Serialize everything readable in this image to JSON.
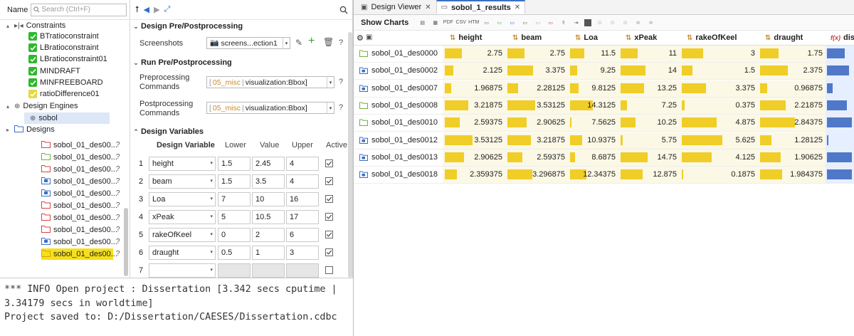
{
  "tree": {
    "name_label": "Name",
    "search_placeholder": "Search (Ctrl+F)",
    "nodes": [
      {
        "kind": "group",
        "label": "Constraints",
        "indent": 0,
        "twisty": "▴"
      },
      {
        "kind": "constraint",
        "label": "BTratioconstraint",
        "ok": true
      },
      {
        "kind": "constraint",
        "label": "LBratioconstraint",
        "ok": true
      },
      {
        "kind": "constraint",
        "label": "LBratioconstraint01",
        "ok": true
      },
      {
        "kind": "constraint",
        "label": "MINDRAFT",
        "ok": true
      },
      {
        "kind": "constraint",
        "label": "MINFREEBOARD",
        "ok": true
      },
      {
        "kind": "constraint",
        "label": "ratioDifference01",
        "ok": false
      },
      {
        "kind": "group",
        "label": "Design Engines",
        "indent": 0,
        "twisty": "▴"
      },
      {
        "kind": "engine",
        "label": "sobol"
      },
      {
        "kind": "folder",
        "label": "Designs",
        "twisty": "▸"
      }
    ],
    "designs": [
      {
        "label": "sobol_01_des00...",
        "color": "red",
        "suffix": "?"
      },
      {
        "label": "sobol_01_des00...",
        "color": "green",
        "suffix": "?"
      },
      {
        "label": "sobol_01_des00...",
        "color": "red",
        "suffix": "?"
      },
      {
        "label": "sobol_01_des00...",
        "color": "blue",
        "suffix": "?"
      },
      {
        "label": "sobol_01_des00...",
        "color": "blue",
        "suffix": "?"
      },
      {
        "label": "sobol_01_des00...",
        "color": "red",
        "suffix": "?"
      },
      {
        "label": "sobol_01_des00...",
        "color": "red",
        "suffix": "?"
      },
      {
        "label": "sobol_01_des00...",
        "color": "red",
        "suffix": "?"
      },
      {
        "label": "sobol_01_des00...",
        "color": "blue",
        "suffix": "?"
      },
      {
        "label": "sobol_01_des00...",
        "color": "yellow",
        "suffix": "?"
      }
    ]
  },
  "props": {
    "section_prepost": "Design Pre/Postprocessing",
    "screenshots_label": "Screenshots",
    "screenshots_value": "screens...ection1",
    "section_run": "Run Pre/Postprocessing",
    "pre_label": "Preprocessing Commands",
    "pre_value_prefix": "05_misc",
    "pre_value": "visualization:Bbox]",
    "post_label": "Postprocessing Commands",
    "post_value_prefix": "05_misc",
    "post_value": "visualization:Bbox]",
    "help_mark": "?",
    "section_vars": "Design Variables",
    "headers": {
      "name": "Design Variable",
      "lower": "Lower",
      "value": "Value",
      "upper": "Upper",
      "active": "Active"
    },
    "variables": [
      {
        "n": "1",
        "name": "height",
        "lower": "1.5",
        "value": "2.45",
        "upper": "4",
        "active": true
      },
      {
        "n": "2",
        "name": "beam",
        "lower": "1.5",
        "value": "3.5",
        "upper": "4",
        "active": true
      },
      {
        "n": "3",
        "name": "Loa",
        "lower": "7",
        "value": "10",
        "upper": "16",
        "active": true
      },
      {
        "n": "4",
        "name": "xPeak",
        "lower": "5",
        "value": "10.5",
        "upper": "17",
        "active": true
      },
      {
        "n": "5",
        "name": "rakeOfKeel",
        "lower": "0",
        "value": "2",
        "upper": "6",
        "active": true
      },
      {
        "n": "6",
        "name": "draught",
        "lower": "0.5",
        "value": "1",
        "upper": "3",
        "active": true
      },
      {
        "n": "7",
        "name": "",
        "lower": "",
        "value": "",
        "upper": "",
        "active": false
      }
    ]
  },
  "console": {
    "lines": [
      "*** INFO Open project : Dissertation [3.342 secs cputime |",
      "3.34179 secs in worldtime]",
      "Project saved to: D:/Dissertation/CAESES/Dissertation.cdbc"
    ]
  },
  "results": {
    "tabs": [
      {
        "label": "Design Viewer",
        "active": false
      },
      {
        "label": "sobol_1_results",
        "active": true
      }
    ],
    "show_charts": "Show Charts",
    "columns": [
      "height",
      "beam",
      "Loa",
      "xPeak",
      "rakeOfKeel",
      "draught",
      "disp"
    ],
    "ranges": {
      "height": [
        1.5,
        4
      ],
      "beam": [
        1.5,
        4
      ],
      "Loa": [
        7,
        16
      ],
      "xPeak": [
        5,
        17
      ],
      "rakeOfKeel": [
        0,
        6
      ],
      "draught": [
        0.5,
        3
      ]
    },
    "rows": [
      {
        "name": "sobol_01_des0000",
        "status": "green",
        "height": "2.75",
        "beam": "2.75",
        "Loa": "11.5",
        "xPeak": "11",
        "rakeOfKeel": "3",
        "draught": "1.75",
        "disp_frac": 0.7
      },
      {
        "name": "sobol_01_des0002",
        "status": "blue",
        "height": "2.125",
        "beam": "3.375",
        "Loa": "9.25",
        "xPeak": "14",
        "rakeOfKeel": "1.5",
        "draught": "2.375",
        "disp_frac": 0.85
      },
      {
        "name": "sobol_01_des0007",
        "status": "blue",
        "height": "1.96875",
        "beam": "2.28125",
        "Loa": "9.8125",
        "xPeak": "13.25",
        "rakeOfKeel": "3.375",
        "draught": "0.96875",
        "disp_frac": 0.22
      },
      {
        "name": "sobol_01_des0008",
        "status": "green",
        "height": "3.21875",
        "beam": "3.53125",
        "Loa": "14.3125",
        "xPeak": "7.25",
        "rakeOfKeel": "0.375",
        "draught": "2.21875",
        "disp_frac": 0.78
      },
      {
        "name": "sobol_01_des0010",
        "status": "green",
        "height": "2.59375",
        "beam": "2.90625",
        "Loa": "7.5625",
        "xPeak": "10.25",
        "rakeOfKeel": "4.875",
        "draught": "2.84375",
        "disp_frac": 0.98
      },
      {
        "name": "sobol_01_des0012",
        "status": "blue",
        "height": "3.53125",
        "beam": "3.21875",
        "Loa": "10.9375",
        "xPeak": "5.75",
        "rakeOfKeel": "5.625",
        "draught": "1.28125",
        "disp_frac": 0.06
      },
      {
        "name": "sobol_01_des0013",
        "status": "blue",
        "height": "2.90625",
        "beam": "2.59375",
        "Loa": "8.6875",
        "xPeak": "14.75",
        "rakeOfKeel": "4.125",
        "draught": "1.90625",
        "disp_frac": 0.98
      },
      {
        "name": "sobol_01_des0018",
        "status": "blue",
        "height": "2.359375",
        "beam": "3.296875",
        "Loa": "12.34375",
        "xPeak": "12.875",
        "rakeOfKeel": "0.1875",
        "draught": "1.984375",
        "disp_frac": 0.98
      }
    ]
  }
}
